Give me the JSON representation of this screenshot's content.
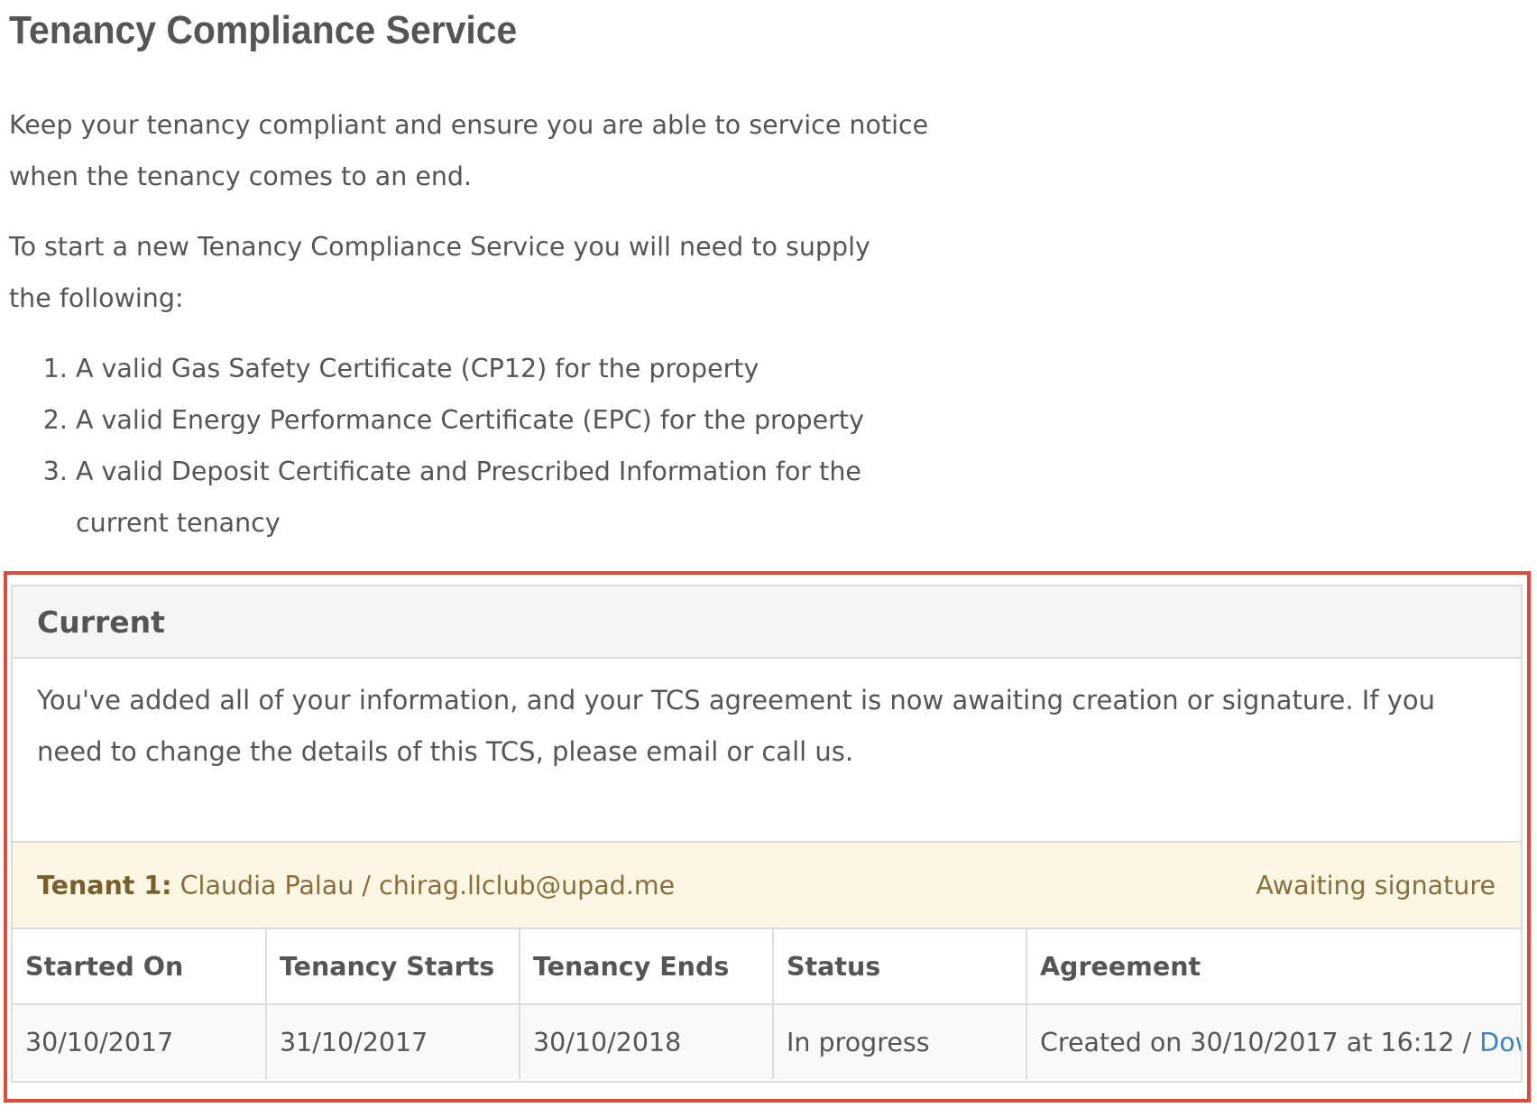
{
  "page": {
    "title": "Tenancy Compliance Service",
    "intro": "Keep your tenancy compliant and ensure you are able to service notice when the tenancy comes to an end.",
    "requirements_intro": "To start a new Tenancy Compliance Service you will need to supply the following:",
    "requirements": [
      "A valid Gas Safety Certificate (CP12) for the property",
      "A valid Energy Performance Certificate (EPC) for the property",
      "A valid Deposit Certificate and Prescribed Information for the current tenancy"
    ]
  },
  "panel": {
    "heading": "Current",
    "message": "You've added all of your information, and your TCS agreement is now awaiting creation or signature. If you need to change the details of this TCS, please email or call us.",
    "tenant": {
      "label": "Tenant 1:",
      "details": "Claudia Palau / chirag.llclub@upad.me",
      "status": "Awaiting signature"
    },
    "table": {
      "headers": [
        "Started On",
        "Tenancy Starts",
        "Tenancy Ends",
        "Status",
        "Agreement"
      ],
      "row": {
        "started_on": "30/10/2017",
        "tenancy_starts": "31/10/2017",
        "tenancy_ends": "30/10/2018",
        "status": "In progress",
        "agreement_text": "Created on 30/10/2017 at 16:12 / ",
        "agreement_link": "Download"
      }
    }
  },
  "colors": {
    "highlight_border": "#e04a3a",
    "tenant_bar_background": "#fcf7e5",
    "link": "#3a83c0"
  }
}
